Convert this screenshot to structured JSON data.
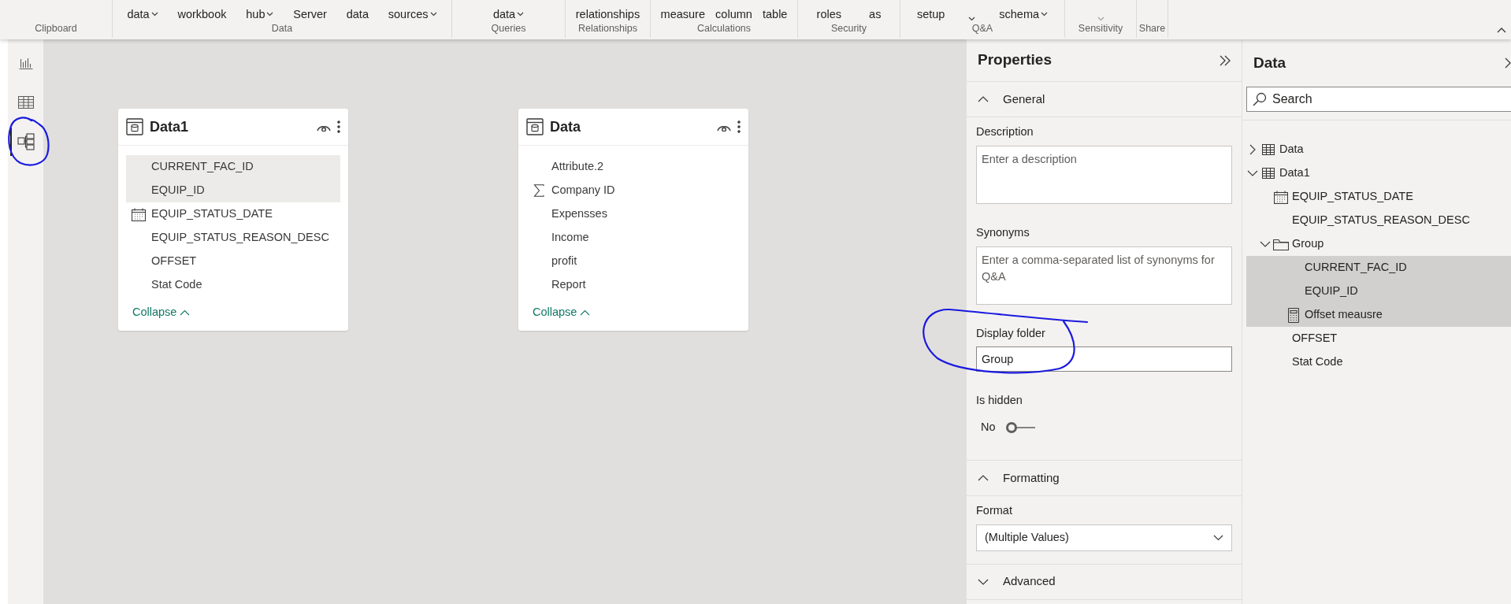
{
  "ribbon": {
    "groups": [
      {
        "label": "Clipboard"
      },
      {
        "label": "Data",
        "buttons": [
          {
            "label": "data",
            "caret": true,
            "disabled": false
          },
          {
            "label": "workbook",
            "caret": false,
            "disabled": false
          },
          {
            "label": "hub",
            "caret": true,
            "disabled": false
          },
          {
            "label": "Server",
            "caret": false,
            "disabled": false
          },
          {
            "label": "data",
            "caret": false,
            "disabled": false
          },
          {
            "label": "sources",
            "caret": true,
            "disabled": false
          }
        ]
      },
      {
        "label": "Queries",
        "buttons": [
          {
            "label": "data",
            "caret": true,
            "disabled": false
          }
        ]
      },
      {
        "label": "Relationships",
        "buttons": [
          {
            "label": "relationships",
            "caret": false,
            "disabled": false
          }
        ]
      },
      {
        "label": "Calculations",
        "buttons": [
          {
            "label": "measure",
            "caret": false,
            "disabled": false
          },
          {
            "label": "column",
            "caret": false,
            "disabled": false
          },
          {
            "label": "table",
            "caret": false,
            "disabled": false
          }
        ]
      },
      {
        "label": "Security",
        "buttons": [
          {
            "label": "roles",
            "caret": false,
            "disabled": false
          },
          {
            "label": "as",
            "caret": false,
            "disabled": false
          }
        ]
      },
      {
        "label": "Q&A",
        "buttons": [
          {
            "label": "setup",
            "caret": false,
            "disabled": false
          },
          {
            "caret": true,
            "disabled": false
          },
          {
            "label": "schema",
            "caret": true,
            "disabled": false
          }
        ]
      },
      {
        "label": "Sensitivity",
        "buttons": [
          {
            "caret": true,
            "disabled": true
          }
        ]
      },
      {
        "label": "Share"
      }
    ]
  },
  "view_rail": {
    "items": [
      {
        "kind": "report",
        "selected": false
      },
      {
        "kind": "table",
        "selected": false
      },
      {
        "kind": "model",
        "selected": true
      }
    ]
  },
  "canvas": {
    "cards": [
      {
        "title": "Data1",
        "collapse_label": "Collapse",
        "fields": [
          {
            "name": "CURRENT_FAC_ID",
            "kind": "column",
            "selected": true
          },
          {
            "name": "EQUIP_ID",
            "kind": "column",
            "selected": true
          },
          {
            "name": "EQUIP_STATUS_DATE",
            "kind": "date",
            "selected": false
          },
          {
            "name": "EQUIP_STATUS_REASON_DESC",
            "kind": "column",
            "selected": false
          },
          {
            "name": "OFFSET",
            "kind": "column",
            "selected": false
          },
          {
            "name": "Stat Code",
            "kind": "column",
            "selected": false
          }
        ]
      },
      {
        "title": "Data",
        "collapse_label": "Collapse",
        "fields": [
          {
            "name": "Attribute.2",
            "kind": "column",
            "selected": false
          },
          {
            "name": "Company ID",
            "kind": "sum",
            "selected": false
          },
          {
            "name": "Expensses",
            "kind": "column",
            "selected": false
          },
          {
            "name": "Income",
            "kind": "column",
            "selected": false
          },
          {
            "name": "profit",
            "kind": "column",
            "selected": false
          },
          {
            "name": "Report",
            "kind": "column",
            "selected": false
          }
        ]
      }
    ]
  },
  "properties": {
    "title": "Properties",
    "sections": [
      {
        "title": "General",
        "expanded": true,
        "fields": [
          {
            "kind": "textarea",
            "label": "Description",
            "placeholder": "Enter a description"
          },
          {
            "kind": "textarea",
            "label": "Synonyms",
            "placeholder": "Enter a comma-separated list of synonyms for Q&A"
          },
          {
            "kind": "text",
            "label": "Display folder",
            "value": "Group"
          },
          {
            "kind": "toggle",
            "label": "Is hidden",
            "on": false,
            "value": "No"
          }
        ]
      },
      {
        "title": "Formatting",
        "expanded": true,
        "fields": [
          {
            "kind": "select",
            "label": "Format",
            "value": "(Multiple Values)"
          }
        ]
      },
      {
        "title": "Advanced",
        "expanded": false
      }
    ]
  },
  "data_pane": {
    "title": "Data",
    "search": {
      "placeholder": "Search"
    },
    "tree": [
      {
        "label": "Data",
        "kind": "table",
        "expanded": false,
        "selected": false
      },
      {
        "label": "Data1",
        "kind": "table",
        "expanded": true,
        "selected": false,
        "children": [
          {
            "label": "EQUIP_STATUS_DATE",
            "kind": "date",
            "selected": false
          },
          {
            "label": "EQUIP_STATUS_REASON_DESC",
            "kind": "column",
            "selected": false
          },
          {
            "label": "Group",
            "kind": "folder",
            "expanded": true,
            "selected": false,
            "children": [
              {
                "label": "CURRENT_FAC_ID",
                "kind": "column",
                "selected": true
              },
              {
                "label": "EQUIP_ID",
                "kind": "column",
                "selected": true
              },
              {
                "label": "Offset meausre",
                "kind": "measure",
                "selected": true
              }
            ]
          },
          {
            "label": "OFFSET",
            "kind": "column",
            "selected": false
          },
          {
            "label": "Stat Code",
            "kind": "column",
            "selected": false
          }
        ]
      }
    ]
  }
}
